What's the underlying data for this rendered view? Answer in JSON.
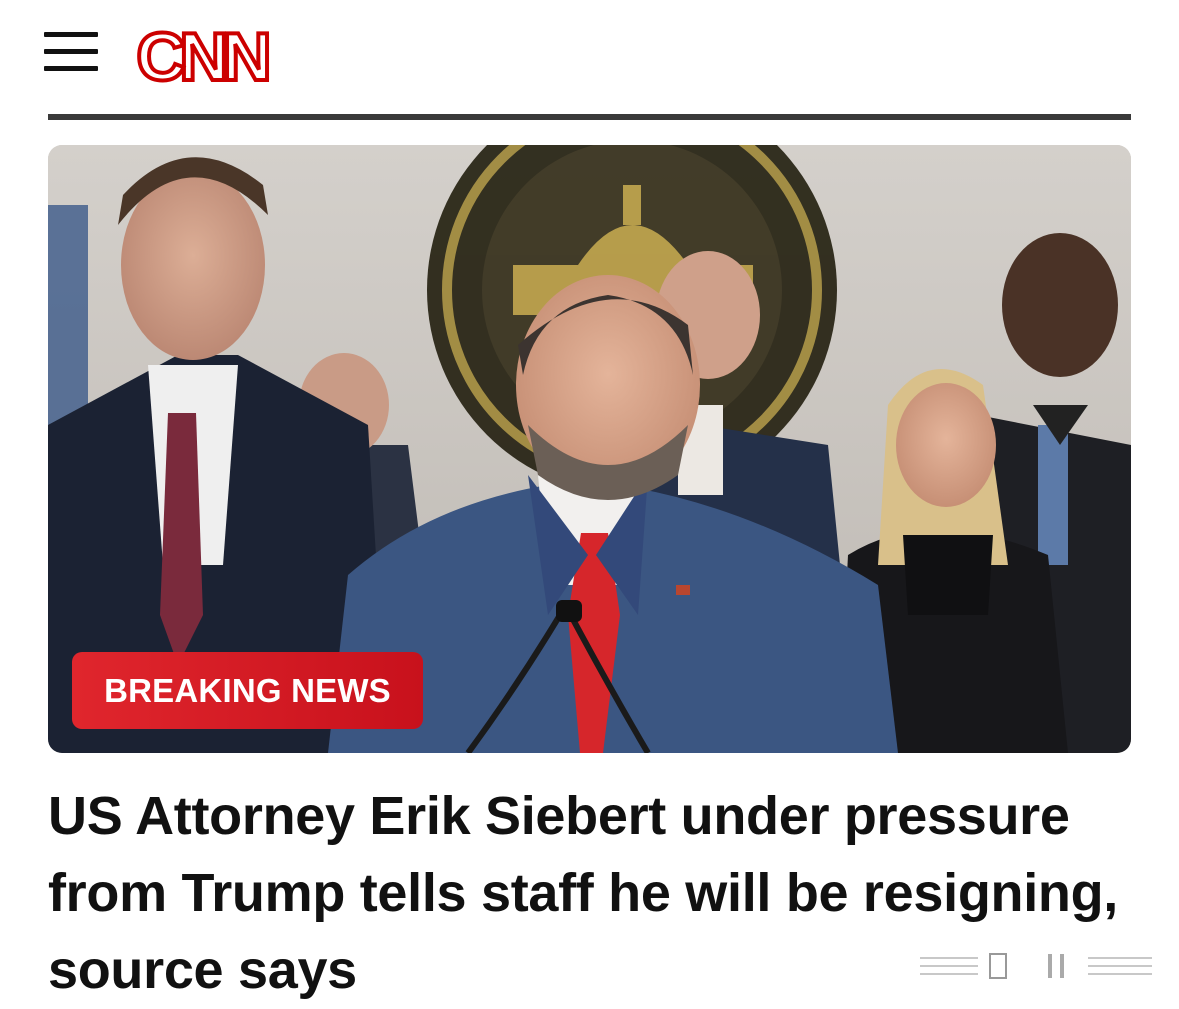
{
  "header": {
    "menu_icon": "hamburger-menu-icon",
    "logo_text": "CNN",
    "brand_color": "#cc0000"
  },
  "hero": {
    "badge_label": "BREAKING NEWS",
    "badge_color": "#d8151f"
  },
  "article": {
    "headline": "US Attorney Erik Siebert under pressure from Trump tells staff he will be resigning, source says"
  }
}
